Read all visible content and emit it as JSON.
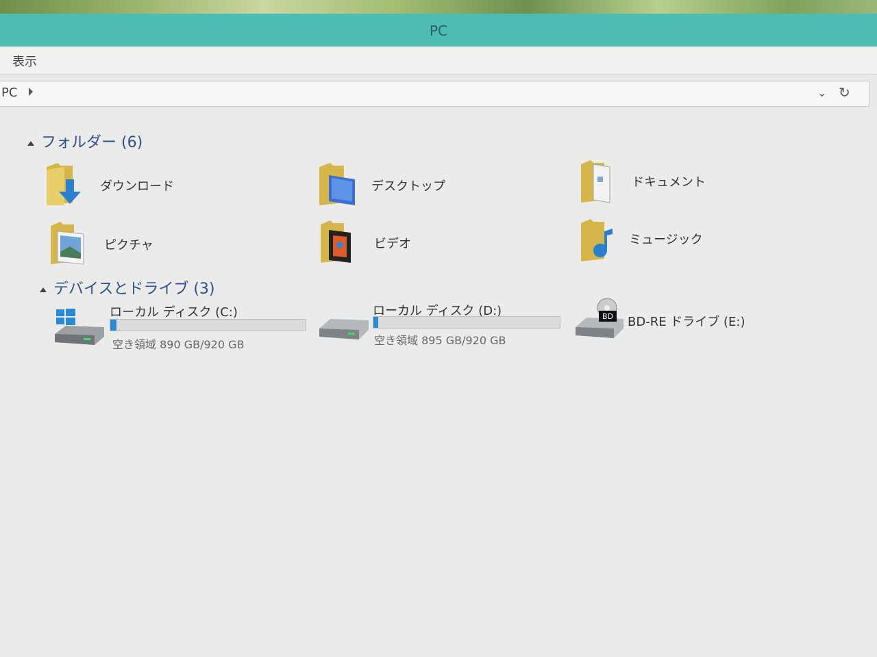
{
  "window": {
    "title": "PC"
  },
  "menubar": {
    "items": [
      "表示"
    ]
  },
  "address": {
    "breadcrumb": "PC",
    "refresh_icon": "refresh-icon",
    "dropdown_icon": "chevron-down-icon"
  },
  "groups": {
    "folders": {
      "header": "フォルダー (6)",
      "items": [
        {
          "label": "ダウンロード",
          "icon": "downloads-folder-icon"
        },
        {
          "label": "デスクトップ",
          "icon": "desktop-folder-icon"
        },
        {
          "label": "ドキュメント",
          "icon": "documents-folder-icon"
        },
        {
          "label": "ピクチャ",
          "icon": "pictures-folder-icon"
        },
        {
          "label": "ビデオ",
          "icon": "videos-folder-icon"
        },
        {
          "label": "ミュージック",
          "icon": "music-folder-icon"
        }
      ]
    },
    "devices": {
      "header": "デバイスとドライブ (3)",
      "items": [
        {
          "label": "ローカル ディスク (C:)",
          "free": "空き領域 890 GB/920 GB",
          "used_fraction": 0.033,
          "icon": "windows-drive-icon"
        },
        {
          "label": "ローカル ディスク (D:)",
          "free": "空き領域 895 GB/920 GB",
          "used_fraction": 0.027,
          "icon": "hard-drive-icon"
        },
        {
          "label": "BD-RE ドライブ (E:)",
          "icon": "bluray-drive-icon"
        }
      ]
    }
  },
  "colors": {
    "titlebar": "#4dbdb4",
    "accent": "#2a8ad4",
    "header_text": "#2f4f8f"
  }
}
